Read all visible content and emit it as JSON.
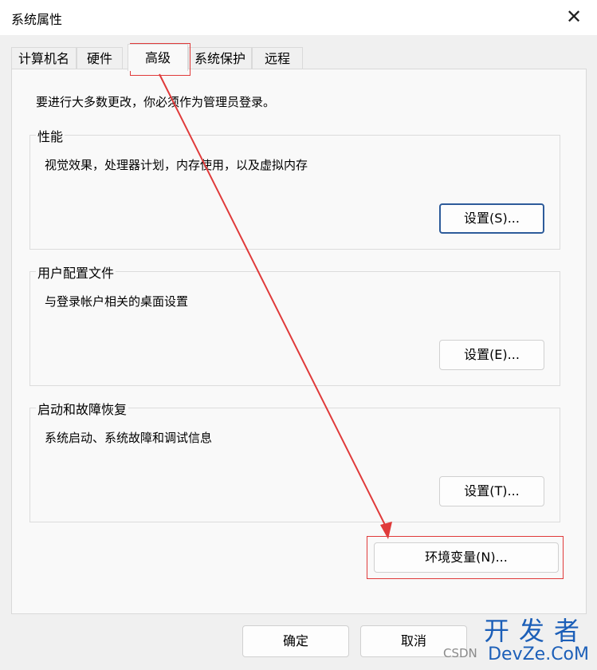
{
  "window": {
    "title": "系统属性",
    "close_glyph": "✕"
  },
  "tabs": [
    {
      "label": "计算机名",
      "active": false
    },
    {
      "label": "硬件",
      "active": false
    },
    {
      "label": "高级",
      "active": true
    },
    {
      "label": "系统保护",
      "active": false
    },
    {
      "label": "远程",
      "active": false
    }
  ],
  "advanced": {
    "admin_note": "要进行大多数更改，你必须作为管理员登录。",
    "performance": {
      "title": "性能",
      "desc": "视觉效果，处理器计划，内存使用，以及虚拟内存",
      "button": "设置(S)..."
    },
    "user_profiles": {
      "title": "用户配置文件",
      "desc": "与登录帐户相关的桌面设置",
      "button": "设置(E)..."
    },
    "startup_recovery": {
      "title": "启动和故障恢复",
      "desc": "系统启动、系统故障和调试信息",
      "button": "设置(T)..."
    },
    "env_button": "环境变量(N)..."
  },
  "footer": {
    "ok": "确定",
    "cancel": "取消"
  },
  "watermark": {
    "top": "开发者",
    "bottom": "DevZe.CoM",
    "source": "CSDN"
  },
  "annotation": {
    "color": "#e03a3a"
  }
}
